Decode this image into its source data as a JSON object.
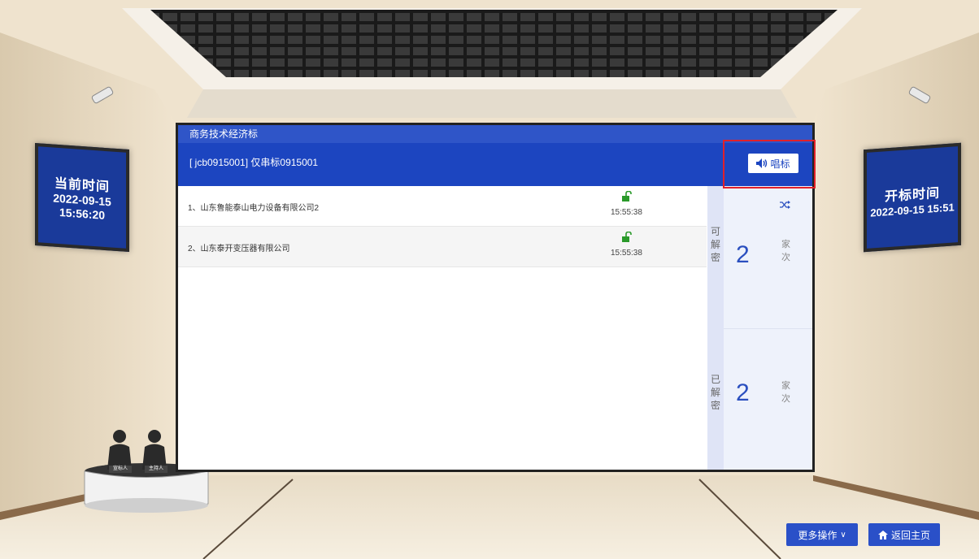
{
  "left_panel": {
    "title": "当前时间",
    "date": "2022-09-15",
    "time": "15:56:20"
  },
  "right_panel": {
    "title": "开标时间",
    "datetime": "2022-09-15 15:51"
  },
  "screen": {
    "section_title": "商务技术经济标",
    "project_title": "[ jcb0915001] 仅串标0915001",
    "sing_button_label": "唱标",
    "bidders": [
      {
        "name": "1、山东鲁能泰山电力设备有限公司2",
        "time": "15:55:38"
      },
      {
        "name": "2、山东泰开变压器有限公司",
        "time": "15:55:38"
      }
    ],
    "stats": {
      "decryptable": {
        "label": [
          "可",
          "解",
          "密"
        ],
        "count": "2",
        "unit": [
          "家",
          "次"
        ]
      },
      "decrypted": {
        "label": [
          "已",
          "解",
          "密"
        ],
        "count": "2",
        "unit": [
          "家",
          "次"
        ]
      }
    }
  },
  "desk": {
    "sign1": "宣标人",
    "sign2": "主持人"
  },
  "buttons": {
    "more_label": "更多操作",
    "home_label": "返回主页"
  },
  "colors": {
    "primary": "#1c45c0",
    "highlight": "#e0202a",
    "lock": "#2a9a2a"
  }
}
